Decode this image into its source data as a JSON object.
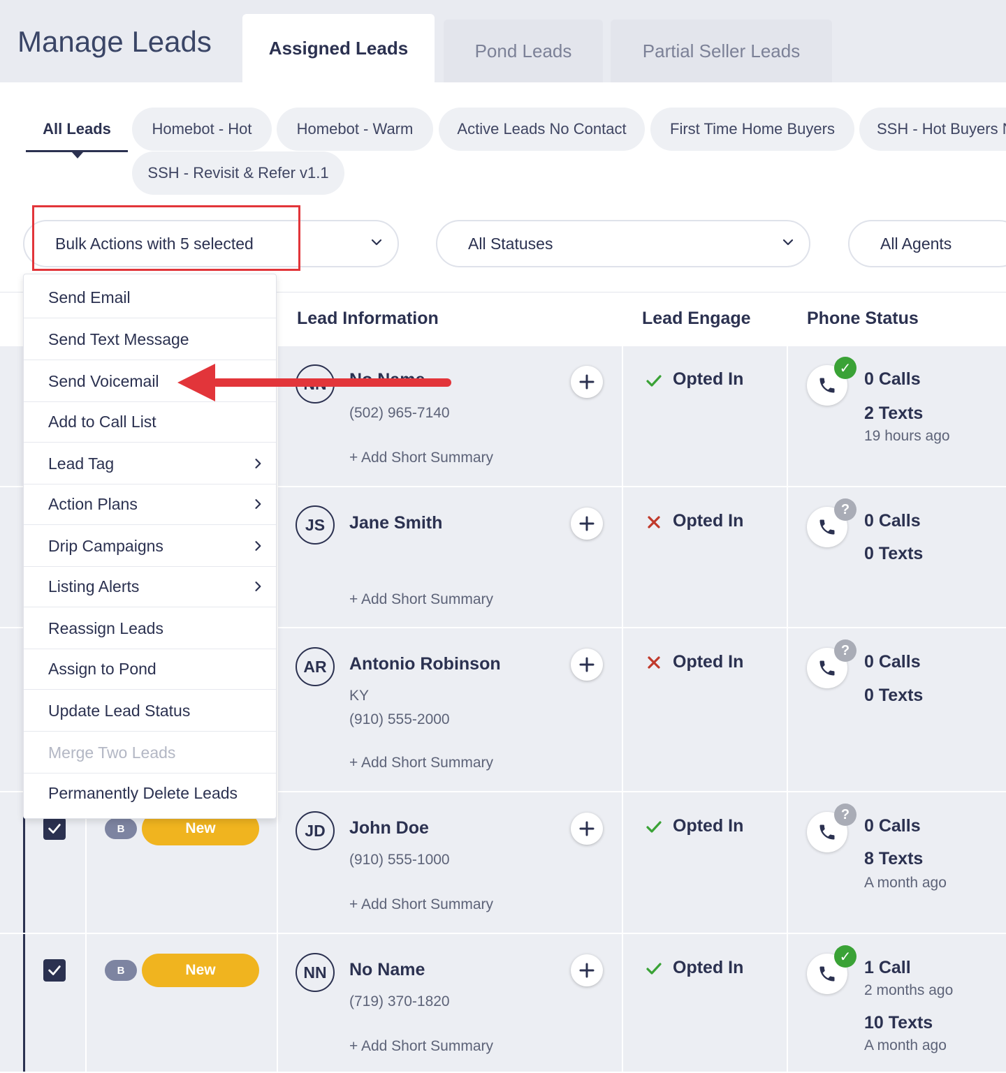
{
  "header": {
    "title": "Manage Leads",
    "tabs": [
      {
        "label": "Assigned Leads",
        "active": true
      },
      {
        "label": "Pond Leads",
        "active": false
      },
      {
        "label": "Partial Seller Leads",
        "active": false
      }
    ]
  },
  "subtabs": {
    "active": "All Leads",
    "chips": [
      "Homebot - Hot",
      "Homebot - Warm",
      "Active Leads No Contact",
      "First Time Home Buyers",
      "SSH - Hot Buyers N",
      "SSH - Revisit & Refer v1.1"
    ]
  },
  "filters": {
    "bulk_actions": "Bulk Actions with 5 selected",
    "statuses": "All Statuses",
    "agents": "All Agents"
  },
  "bulk_menu": {
    "items": [
      {
        "label": "Send Email",
        "submenu": false,
        "disabled": false
      },
      {
        "label": "Send Text Message",
        "submenu": false,
        "disabled": false
      },
      {
        "label": "Send Voicemail",
        "submenu": false,
        "disabled": false
      },
      {
        "label": "Add to Call List",
        "submenu": false,
        "disabled": false
      },
      {
        "label": "Lead Tag",
        "submenu": true,
        "disabled": false
      },
      {
        "label": "Action Plans",
        "submenu": true,
        "disabled": false
      },
      {
        "label": "Drip Campaigns",
        "submenu": true,
        "disabled": false
      },
      {
        "label": "Listing Alerts",
        "submenu": true,
        "disabled": false
      },
      {
        "label": "Reassign Leads",
        "submenu": false,
        "disabled": false
      },
      {
        "label": "Assign to Pond",
        "submenu": false,
        "disabled": false
      },
      {
        "label": "Update Lead Status",
        "submenu": false,
        "disabled": false
      },
      {
        "label": "Merge Two Leads",
        "submenu": false,
        "disabled": true
      },
      {
        "label": "Permanently Delete Leads",
        "submenu": false,
        "disabled": false
      }
    ]
  },
  "table": {
    "columns": [
      "Lead Information",
      "Lead Engage",
      "Phone Status"
    ],
    "rows": [
      {
        "initials": "NN",
        "name": "No Name",
        "phone": "(502) 965-7140",
        "summary": "+ Add Short Summary",
        "engage_label": "Opted In",
        "engage_ok": true,
        "phone_badge": "ok",
        "calls": "0 Calls",
        "texts": "2 Texts",
        "texts_time": "19 hours ago"
      },
      {
        "initials": "JS",
        "name": "Jane Smith",
        "summary": "+ Add Short Summary",
        "engage_label": "Opted In",
        "engage_ok": false,
        "phone_badge": "?",
        "calls": "0 Calls",
        "texts": "0 Texts"
      },
      {
        "initials": "AR",
        "name": "Antonio Robinson",
        "state": "KY",
        "phone": "(910) 555-2000",
        "summary": "+ Add Short Summary",
        "engage_label": "Opted In",
        "engage_ok": false,
        "phone_badge": "?",
        "calls": "0 Calls",
        "texts": "0 Texts"
      },
      {
        "initials": "JD",
        "name": "John Doe",
        "phone": "(910) 555-1000",
        "summary": "+ Add Short Summary",
        "badge": "B",
        "status": "New",
        "checked": true,
        "engage_label": "Opted In",
        "engage_ok": true,
        "phone_badge": "?",
        "calls": "0 Calls",
        "texts": "8 Texts",
        "texts_time": "A month ago"
      },
      {
        "initials": "NN",
        "name": "No Name",
        "phone": "(719) 370-1820",
        "summary": "+ Add Short Summary",
        "badge": "B",
        "status": "New",
        "checked": true,
        "engage_label": "Opted In",
        "engage_ok": true,
        "phone_badge": "ok",
        "calls": "1 Call",
        "calls_time": "2 months ago",
        "texts": "10 Texts",
        "texts_time": "A month ago"
      }
    ]
  },
  "colors": {
    "primary": "#2b3150",
    "highlight": "#e2353a",
    "new_status": "#f0b41f",
    "ok_green": "#3aa236",
    "x_red": "#c0392b"
  }
}
